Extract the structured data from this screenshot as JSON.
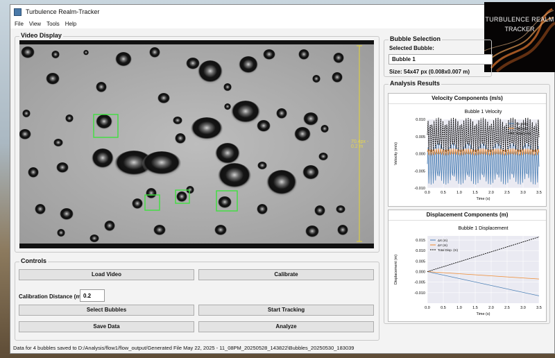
{
  "window": {
    "title": "Turbulence Realm-Tracker"
  },
  "menu": [
    "File",
    "View",
    "Tools",
    "Help"
  ],
  "video": {
    "title": "Video Display",
    "calibration_overlay": "70.4px - 0.2 m"
  },
  "bubble_selection": {
    "title": "Bubble Selection",
    "selected_label": "Selected Bubble:",
    "selected_value": "Bubble 1",
    "size_text": "Size: 54x47 px (0.008x0.007 m)"
  },
  "logo": {
    "line1": "TURBULENCE REALM",
    "line2": "TRACKER"
  },
  "analysis": {
    "title": "Analysis Results",
    "velocity_panel_title": "Velocity Components (m/s)",
    "displacement_panel_title": "Displacement Components (m)"
  },
  "controls": {
    "title": "Controls",
    "load_video": "Load Video",
    "calibrate": "Calibrate",
    "calibration_label": "Calibration Distance (m):",
    "calibration_value": "0.2",
    "select_bubbles": "Select Bubbles",
    "start_tracking": "Start Tracking",
    "save_data": "Save Data",
    "analyze": "Analyze"
  },
  "status": "Data for 4 bubbles saved to D:/Analysis/flow1/flow_output/Generated File May 22, 2025 - 11_08PM_20250528_143822\\Bubbles_20250530_183039",
  "chart_data": [
    {
      "type": "line",
      "title": "Bubble 1 Velocity",
      "xlabel": "Time (s)",
      "ylabel": "Velocity (m/s)",
      "xlim": [
        0.0,
        3.5
      ],
      "ylim": [
        -0.01,
        0.01
      ],
      "xticks": [
        "0.0",
        "0.5",
        "1.0",
        "1.5",
        "2.0",
        "2.5",
        "3.0",
        "3.5"
      ],
      "yticks": [
        "-0.010",
        "-0.005",
        "0.000",
        "0.005",
        "0.010"
      ],
      "legend_position": "top-right",
      "series": [
        {
          "name": "Vx (m/s)",
          "color": "#4a7fb5",
          "amplitude": 0.006,
          "offset": -0.003
        },
        {
          "name": "Vy (m/s)",
          "color": "#f08a2e",
          "amplitude": 0.001,
          "offset": 0.0005
        },
        {
          "name": "Total (m/s)",
          "color": "#000000",
          "amplitude": 0.005,
          "offset": 0.0055,
          "dashed": true
        }
      ]
    },
    {
      "type": "line",
      "title": "Bubble 1 Displacement",
      "xlabel": "Time (s)",
      "ylabel": "Displacement (m)",
      "xlim": [
        0.0,
        3.5
      ],
      "ylim": [
        -0.015,
        0.017
      ],
      "xticks": [
        "0.0",
        "0.5",
        "1.0",
        "1.5",
        "2.0",
        "2.5",
        "3.0",
        "3.5"
      ],
      "yticks": [
        "-0.010",
        "-0.005",
        "0.000",
        "0.005",
        "0.010",
        "0.015"
      ],
      "legend_position": "top-left",
      "series": [
        {
          "name": "ΔX (m)",
          "color": "#4a7fb5",
          "x": [
            0.0,
            3.5
          ],
          "y": [
            0.0,
            -0.0115
          ]
        },
        {
          "name": "ΔY (m)",
          "color": "#f08a2e",
          "x": [
            0.0,
            3.5
          ],
          "y": [
            0.0,
            -0.0035
          ]
        },
        {
          "name": "Total Disp. (m)",
          "color": "#000000",
          "x": [
            0.0,
            3.5
          ],
          "y": [
            0.0,
            0.0165
          ],
          "dashed": true
        }
      ]
    }
  ]
}
